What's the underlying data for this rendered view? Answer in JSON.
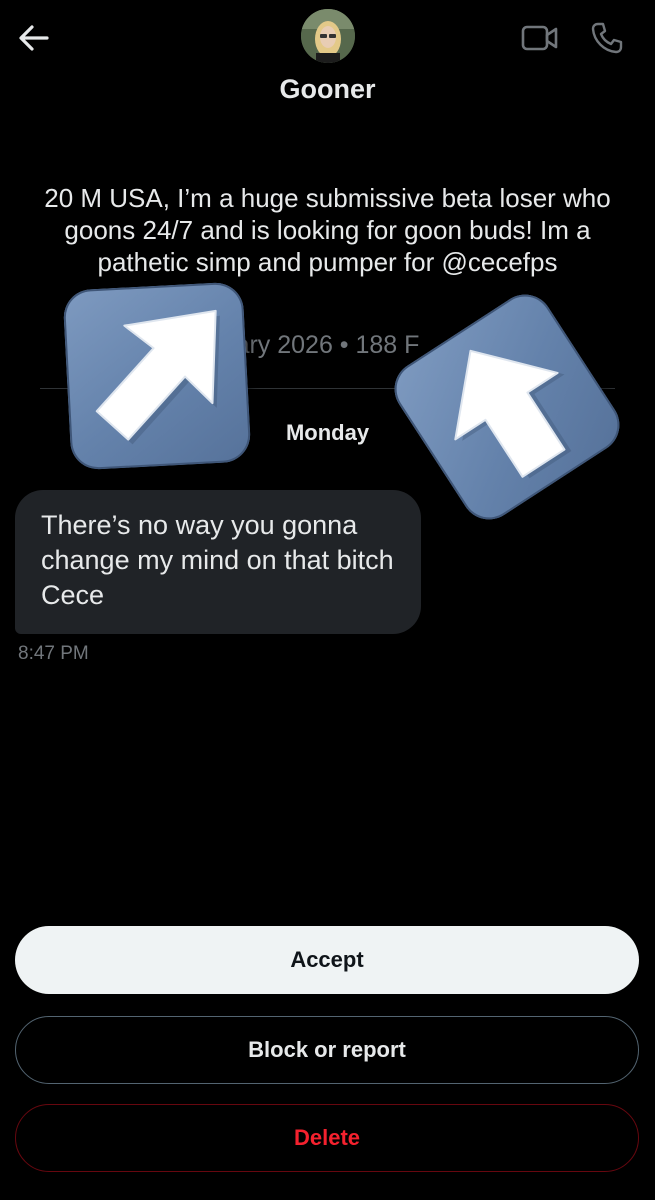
{
  "header": {
    "back_icon": "arrow-left-icon",
    "video_icon": "video-camera-icon",
    "call_icon": "phone-icon",
    "name": "Gooner"
  },
  "profile": {
    "bio": "20 M USA, I’m a huge submissive beta loser who goons 24/7 and is looking for goon buds! Im a pathetic simp and pumper for @cecefps",
    "meta_visible": "ary 2026 • 188 F"
  },
  "conversation": {
    "day_label": "Monday",
    "messages": [
      {
        "text": "There’s no way you gonna change my mind on that bitch Cece",
        "time": "8:47 PM"
      }
    ]
  },
  "stickers": [
    {
      "icon": "arrow-up-right-icon"
    },
    {
      "icon": "arrow-up-icon"
    }
  ],
  "actions": {
    "accept": "Accept",
    "block": "Block or report",
    "delete": "Delete"
  },
  "colors": {
    "background": "#000000",
    "bubble": "#202327",
    "muted": "#71767b",
    "danger": "#f4212e",
    "sticker": "#6482ab"
  }
}
